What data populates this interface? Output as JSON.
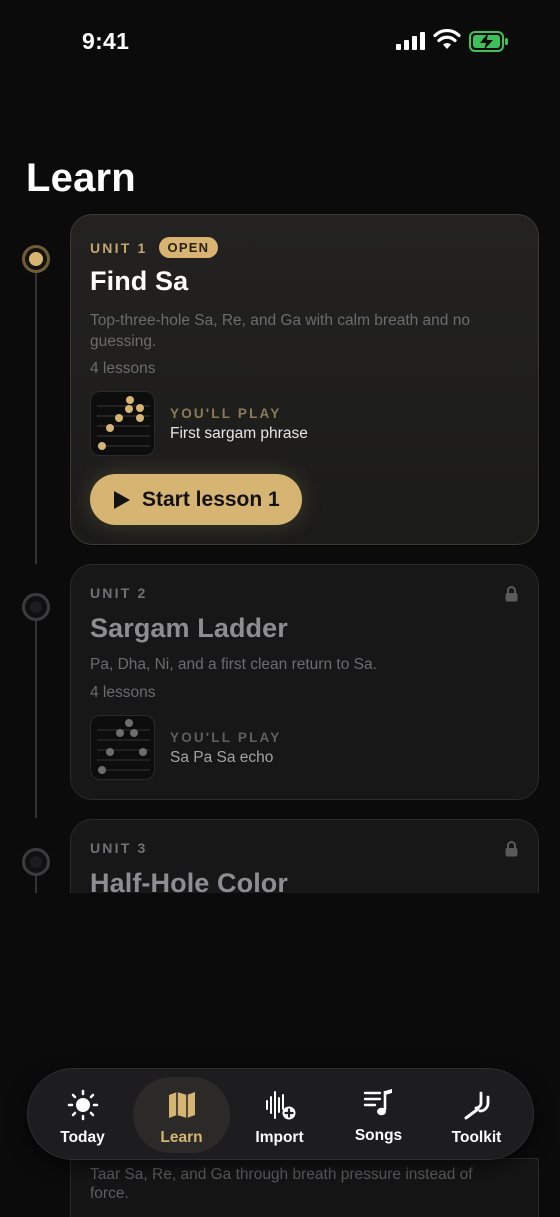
{
  "status_bar": {
    "time": "9:41"
  },
  "header": {
    "title": "Learn"
  },
  "units": [
    {
      "unit": "UNIT 1",
      "badge": "OPEN",
      "title": "Find Sa",
      "description": "Top-three-hole Sa, Re, and Ga with calm breath and no guessing.",
      "lessons": "4 lessons",
      "play_label": "YOU'LL PLAY",
      "play_value": "First sargam phrase",
      "button": "Start lesson 1",
      "state": "open"
    },
    {
      "unit": "UNIT 2",
      "title": "Sargam Ladder",
      "description": "Pa, Dha, Ni, and a first clean return to Sa.",
      "lessons": "4 lessons",
      "play_label": "YOU'LL PLAY",
      "play_value": "Sa Pa Sa echo",
      "state": "locked"
    },
    {
      "unit": "UNIT 3",
      "title": "Half-Hole Color",
      "description": "Taar Sa, Re, and Ga through breath pressure instead of force.",
      "state": "locked"
    }
  ],
  "tabbar": {
    "tabs": [
      {
        "label": "Today",
        "icon": "sun-icon"
      },
      {
        "label": "Learn",
        "icon": "map-icon",
        "active": true
      },
      {
        "label": "Import",
        "icon": "waveform-plus-icon"
      },
      {
        "label": "Songs",
        "icon": "music-list-icon"
      },
      {
        "label": "Toolkit",
        "icon": "tuning-fork-icon"
      }
    ]
  },
  "colors": {
    "accent": "#d6b472",
    "background": "#0b0b0c"
  }
}
